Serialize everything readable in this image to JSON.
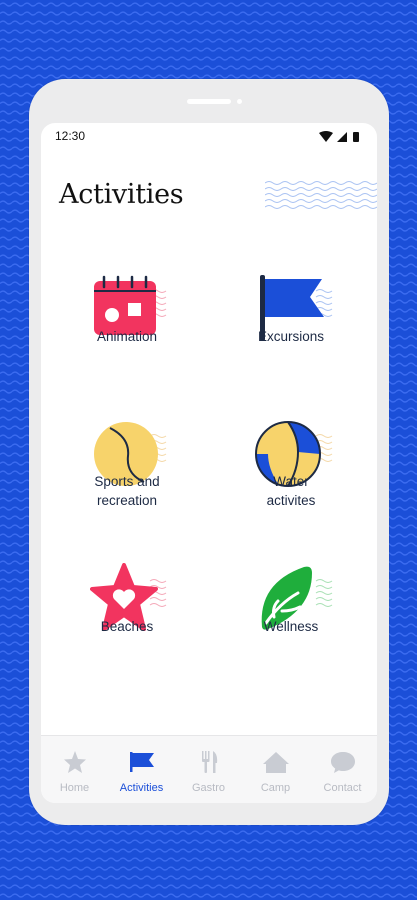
{
  "status": {
    "time": "12:30"
  },
  "page": {
    "title": "Activities"
  },
  "colors": {
    "brand_blue": "#1b4fd8",
    "accent_pink": "#f2345f",
    "accent_yellow": "#f7d36b",
    "accent_green": "#1fae3c",
    "nav_inactive": "#b8bbc3"
  },
  "activities": [
    {
      "label": "Animation",
      "icon": "calendar-icon"
    },
    {
      "label": "Excursions",
      "icon": "flag-icon"
    },
    {
      "label_line1": "Sports and",
      "label_line2": "recreation",
      "icon": "tennis-ball-icon"
    },
    {
      "label_line1": "Water",
      "label_line2": "activites",
      "icon": "beach-ball-icon"
    },
    {
      "label": "Beaches",
      "icon": "star-heart-icon"
    },
    {
      "label": "Wellness",
      "icon": "leaf-icon"
    }
  ],
  "nav": [
    {
      "label": "Home",
      "icon": "star-icon",
      "active": false
    },
    {
      "label": "Activities",
      "icon": "flag-icon",
      "active": true
    },
    {
      "label": "Gastro",
      "icon": "cutlery-icon",
      "active": false
    },
    {
      "label": "Camp",
      "icon": "tent-icon",
      "active": false
    },
    {
      "label": "Contact",
      "icon": "chat-bubble-icon",
      "active": false
    }
  ]
}
